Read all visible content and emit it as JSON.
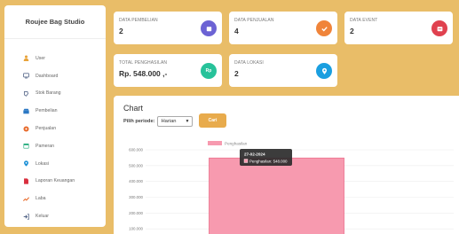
{
  "sidebar": {
    "brand": "Roujee Bag Studio",
    "items": [
      {
        "label": "User",
        "icon": "user-icon",
        "color": "#e8a33a"
      },
      {
        "label": "Dashboard",
        "icon": "monitor-icon",
        "color": "#5a6b8c"
      },
      {
        "label": "Stok Barang",
        "icon": "stock-icon",
        "color": "#5a6b8c"
      },
      {
        "label": "Pembelian",
        "icon": "purchase-icon",
        "color": "#2b78c4"
      },
      {
        "label": "Penjualan",
        "icon": "sales-icon",
        "color": "#e86a2b"
      },
      {
        "label": "Pameran",
        "icon": "calendar-icon",
        "color": "#1faa7a"
      },
      {
        "label": "Lokasi",
        "icon": "location-icon",
        "color": "#1a8fd6"
      },
      {
        "label": "Laporan Keuangan",
        "icon": "report-icon",
        "color": "#d92d3d"
      },
      {
        "label": "Laba",
        "icon": "profit-icon",
        "color": "#e86a2b"
      },
      {
        "label": "Keluar",
        "icon": "logout-icon",
        "color": "#5a6b8c"
      }
    ]
  },
  "cards": {
    "pembelian": {
      "label": "DATA PEMBELIAN",
      "value": "2",
      "color": "#6c63d4"
    },
    "penjualan": {
      "label": "DATA PENJUALAN",
      "value": "4",
      "color": "#f0843a"
    },
    "event": {
      "label": "DATA EVENT",
      "value": "2",
      "color": "#e0414f"
    },
    "penghasilan": {
      "label": "TOTAL PENGHASILAN",
      "value": "Rp. 548.000 ,-",
      "badge": "Rp",
      "color": "#27c29a"
    },
    "lokasi": {
      "label": "DATA LOKASI",
      "value": "2",
      "color": "#1a9fe0"
    }
  },
  "chart_panel": {
    "title": "Chart",
    "period_label": "Pilih periode:",
    "period_value": "Harian",
    "search_button": "Cari"
  },
  "chart_data": {
    "type": "bar",
    "categories": [
      "27-02-2024"
    ],
    "series": [
      {
        "name": "Penghasilan",
        "values": [
          548000
        ],
        "color": "#f79aaf"
      }
    ],
    "ylim": [
      0,
      600000
    ],
    "yticks": [
      "100.000",
      "200.000",
      "300.000",
      "400.000",
      "500.000",
      "600.000"
    ],
    "legend_position": "top-center",
    "tooltip": {
      "title": "27-02-2024",
      "text": "Penghasilan: 548.000"
    }
  }
}
